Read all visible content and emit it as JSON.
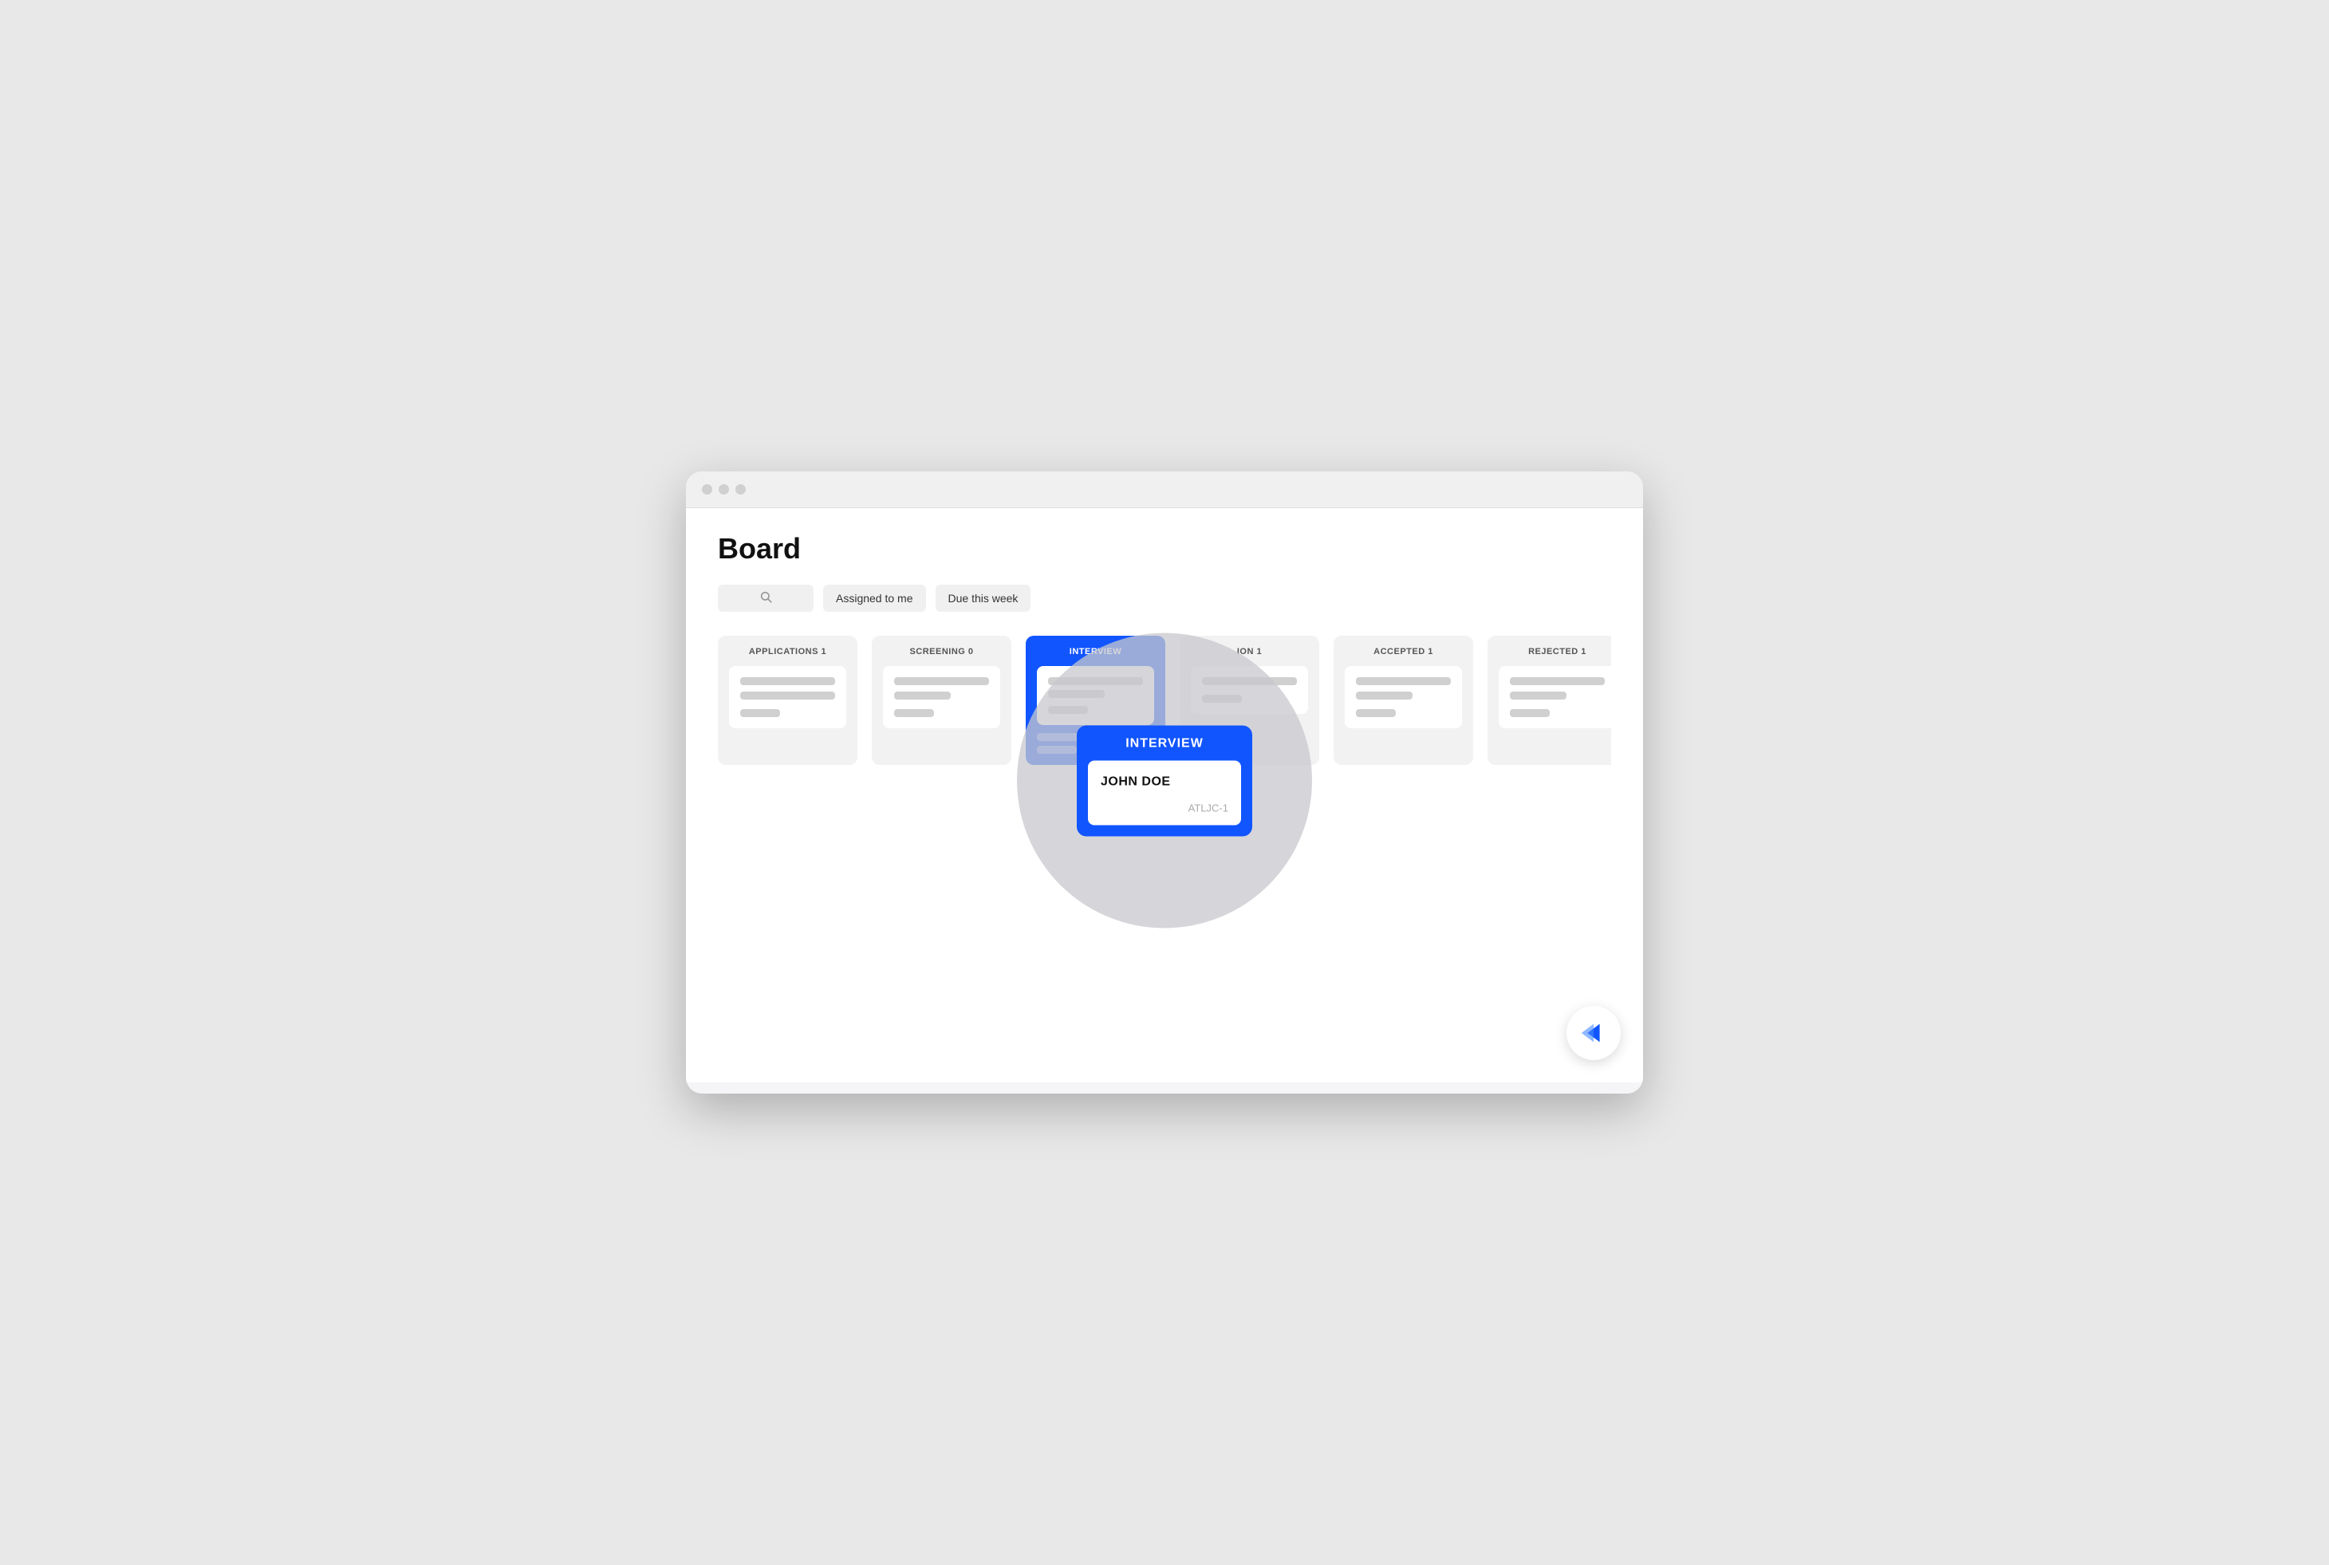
{
  "page": {
    "title": "Board",
    "browser_dots": [
      "dot1",
      "dot2",
      "dot3"
    ]
  },
  "toolbar": {
    "search_placeholder": "Search",
    "filter_assigned": "Assigned to me",
    "filter_due": "Due this week"
  },
  "columns": [
    {
      "id": "applications",
      "title": "APPLICATIONS 1",
      "cards": [
        {
          "lines": [
            "full",
            "full",
            "short"
          ],
          "tag": true
        },
        {
          "lines": [],
          "tag": false
        }
      ]
    },
    {
      "id": "screening",
      "title": "SCREENING 0",
      "cards": [
        {
          "lines": [
            "full",
            "short"
          ],
          "tag": true
        }
      ]
    },
    {
      "id": "interview",
      "title": "INTERVIEW",
      "cards": [
        {
          "name": "JOHN DOE",
          "id": "ATLJC-1"
        }
      ],
      "highlighted": true
    },
    {
      "id": "offer",
      "title": "ION 1",
      "cards": [
        {
          "lines": [
            "full"
          ],
          "tag": true
        }
      ]
    },
    {
      "id": "accepted",
      "title": "ACCEPTED 1",
      "cards": [
        {
          "lines": [
            "full",
            "short"
          ],
          "tag": true
        }
      ]
    },
    {
      "id": "rejected",
      "title": "REJECTED 1",
      "cards": [
        {
          "lines": [
            "full",
            "short"
          ],
          "tag": true
        }
      ]
    }
  ],
  "spotlight": {
    "column_title": "INTERVIEW",
    "card_name": "JOHN DOE",
    "card_id": "ATLJC-1"
  },
  "logo": {
    "label": "App Logo"
  }
}
